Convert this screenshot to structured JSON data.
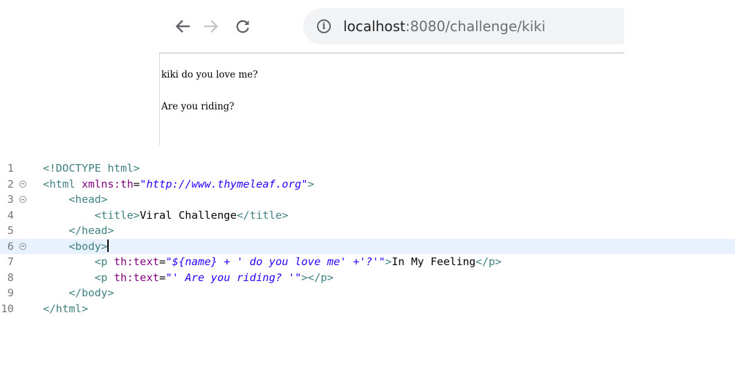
{
  "browser": {
    "url_host": "localhost",
    "url_rest": ":8080/challenge/kiki",
    "info_icon": "i",
    "icons": {
      "back": "arrow-left-icon",
      "forward": "arrow-right-icon",
      "reload": "reload-icon",
      "info": "info-icon"
    },
    "page_lines": [
      "kiki do you love me?",
      "Are you riding?"
    ]
  },
  "editor": {
    "line_numbers": [
      "1",
      "2",
      "3",
      "4",
      "5",
      "6",
      "7",
      "8",
      "9",
      "10"
    ],
    "folded_lines": [
      2,
      3,
      6
    ],
    "current_line": 6,
    "lines": [
      [
        {
          "t": "<!DOCTYPE ",
          "c": "doctype"
        },
        {
          "t": "html",
          "c": "tag"
        },
        {
          "t": ">",
          "c": "doctype"
        }
      ],
      [
        {
          "t": "<html ",
          "c": "tag"
        },
        {
          "t": "xmlns:th",
          "c": "attr"
        },
        {
          "t": "=",
          "c": "punc"
        },
        {
          "t": "\"http://www.thymeleaf.org\"",
          "c": "str"
        },
        {
          "t": ">",
          "c": "tag"
        }
      ],
      [
        {
          "t": "    <head>",
          "c": "tag"
        }
      ],
      [
        {
          "t": "        <title>",
          "c": "tag"
        },
        {
          "t": "Viral Challenge",
          "c": "text"
        },
        {
          "t": "</title>",
          "c": "tag"
        }
      ],
      [
        {
          "t": "    </head>",
          "c": "tag"
        }
      ],
      [
        {
          "t": "    <body>",
          "c": "body-tag"
        }
      ],
      [
        {
          "t": "        <p ",
          "c": "tag"
        },
        {
          "t": "th:text",
          "c": "attr"
        },
        {
          "t": "=",
          "c": "punc"
        },
        {
          "t": "\"${name} + ' do you love me' +'?'\"",
          "c": "str"
        },
        {
          "t": ">",
          "c": "tag"
        },
        {
          "t": "In My Feeling",
          "c": "text"
        },
        {
          "t": "</p>",
          "c": "tag"
        }
      ],
      [
        {
          "t": "        <p ",
          "c": "tag"
        },
        {
          "t": "th:text",
          "c": "attr"
        },
        {
          "t": "=",
          "c": "punc"
        },
        {
          "t": "\"' Are you riding? '\"",
          "c": "str"
        },
        {
          "t": "></p>",
          "c": "tag"
        }
      ],
      [
        {
          "t": "    </body>",
          "c": "tag"
        }
      ],
      [
        {
          "t": "</html>",
          "c": "tag"
        }
      ]
    ]
  }
}
